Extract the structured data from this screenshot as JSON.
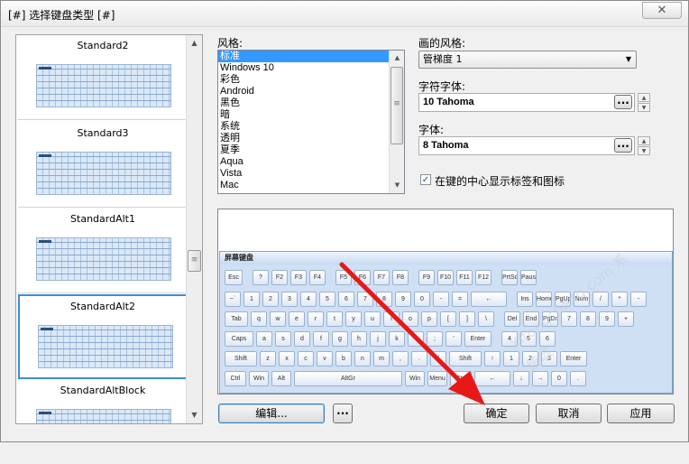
{
  "window": {
    "title": "[#] 选择键盘类型 [#]",
    "close_glyph": "✕"
  },
  "layouts": {
    "items": [
      {
        "name": "Standard2",
        "selected": false
      },
      {
        "name": "Standard3",
        "selected": false
      },
      {
        "name": "StandardAlt1",
        "selected": false
      },
      {
        "name": "StandardAlt2",
        "selected": true
      },
      {
        "name": "StandardAltBlock",
        "selected": false
      }
    ]
  },
  "style": {
    "label": "风格:",
    "options": [
      "标准",
      "Windows 10",
      "彩色",
      "Android",
      "黑色",
      "暗",
      "系统",
      "透明",
      "夏季",
      "Aqua",
      "Vista",
      "Mac"
    ],
    "selected_index": 0
  },
  "paint_style": {
    "label": "画的风格:",
    "value": "管梯度 1"
  },
  "char_font": {
    "label": "字符字体:",
    "value": "10 Tahoma",
    "browse": "..."
  },
  "font": {
    "label": "字体:",
    "value": "8 Tahoma",
    "browse": "..."
  },
  "show_center": {
    "label": "在键的中心显示标签和图标",
    "checked": true,
    "check_glyph": "✓"
  },
  "preview": {
    "header": "屏幕键盘",
    "rows": [
      [
        "Esc",
        "?",
        "F2",
        "F3",
        "F4",
        "F5",
        "F6",
        "F7",
        "F8",
        "F9",
        "F10",
        "F11",
        "F12",
        "PrtSc",
        "Pause"
      ],
      [
        "~`",
        "1",
        "2",
        "3",
        "4",
        "5",
        "6",
        "7",
        "8",
        "9",
        "0",
        "-",
        "=",
        "←",
        "Ins",
        "Home",
        "PgUp",
        "Num",
        "/",
        "*",
        "-"
      ],
      [
        "Tab",
        "q",
        "w",
        "e",
        "r",
        "t",
        "y",
        "u",
        "i",
        "o",
        "p",
        "[",
        "]",
        "\\",
        "Del",
        "End",
        "PgDn",
        "7",
        "8",
        "9",
        "+"
      ],
      [
        "Caps",
        "a",
        "s",
        "d",
        "f",
        "g",
        "h",
        "j",
        "k",
        "l",
        ";",
        "'",
        "Enter",
        "4",
        "5",
        "6"
      ],
      [
        "Shift",
        "z",
        "x",
        "c",
        "v",
        "b",
        "n",
        "m",
        ",",
        ".",
        "/",
        "Shift",
        "↑",
        "1",
        "2",
        "3",
        "Enter"
      ],
      [
        "Ctrl",
        "Win",
        "Alt",
        "AltGr",
        "Win",
        "Menu",
        "Ctrl",
        "←",
        "↓",
        "→",
        "0",
        "."
      ]
    ]
  },
  "buttons": {
    "edit": "编辑...",
    "more": "...",
    "ok": "确定",
    "cancel": "取消",
    "apply": "应用"
  },
  "watermark": "Xitongcheng.com 系统城"
}
